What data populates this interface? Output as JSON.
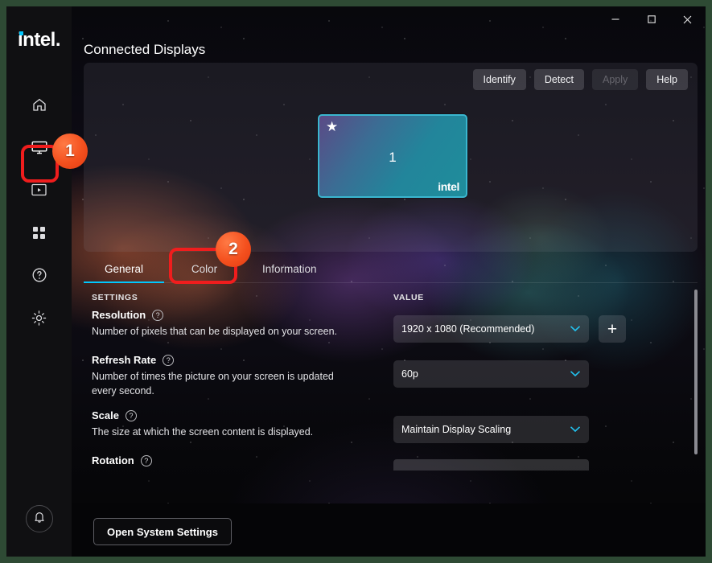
{
  "window": {
    "brand": "intel",
    "page_title": "Connected Displays",
    "controls": {
      "minimize": "minimize-icon",
      "maximize": "maximize-icon",
      "close": "close-icon"
    }
  },
  "sidebar": {
    "items": [
      {
        "id": "home",
        "icon": "home-icon",
        "label": "Home",
        "active": false
      },
      {
        "id": "display",
        "icon": "monitor-icon",
        "label": "Display",
        "active": true
      },
      {
        "id": "video",
        "icon": "video-icon",
        "label": "Video",
        "active": false
      },
      {
        "id": "apps",
        "icon": "grid-apps-icon",
        "label": "Apps",
        "active": false
      },
      {
        "id": "support",
        "icon": "question-circle-icon",
        "label": "Support",
        "active": false
      },
      {
        "id": "preferences",
        "icon": "gear-icon",
        "label": "Preferences",
        "active": false
      }
    ],
    "notification": {
      "icon": "bell-icon",
      "label": "Notifications"
    }
  },
  "toolbar": {
    "identify_label": "Identify",
    "detect_label": "Detect",
    "apply_label": "Apply",
    "apply_disabled": true,
    "help_label": "Help"
  },
  "display_preview": {
    "monitor": {
      "number": "1",
      "primary_star": "★",
      "brand": "intel",
      "selected": true,
      "border_color": "#3ab6cf"
    }
  },
  "tabs": [
    {
      "id": "general",
      "label": "General",
      "active": true
    },
    {
      "id": "color",
      "label": "Color",
      "active": false
    },
    {
      "id": "information",
      "label": "Information",
      "active": false
    }
  ],
  "settings_panel": {
    "column_headers": {
      "settings": "SETTINGS",
      "value": "VALUE"
    },
    "rows": [
      {
        "id": "resolution",
        "name": "Resolution",
        "help_icon": "question-circle-icon",
        "description": "Number of pixels that can be displayed on your screen.",
        "control": "select",
        "value": "1920 x 1080 (Recommended)",
        "chevron": "chevron-down-icon",
        "extra_button": {
          "icon": "plus-icon",
          "label": "+"
        }
      },
      {
        "id": "refresh-rate",
        "name": "Refresh Rate",
        "help_icon": "question-circle-icon",
        "description": "Number of times the picture on your screen is updated every second.",
        "control": "select",
        "value": "60p",
        "chevron": "chevron-down-icon"
      },
      {
        "id": "scale",
        "name": "Scale",
        "help_icon": "question-circle-icon",
        "description": "The size at which the screen content is displayed.",
        "control": "select",
        "value": "Maintain Display Scaling",
        "chevron": "chevron-down-icon"
      },
      {
        "id": "rotation",
        "name": "Rotation",
        "help_icon": "question-circle-icon",
        "description": "",
        "control": "select-clipped",
        "value": ""
      }
    ]
  },
  "footer": {
    "open_system_settings_label": "Open System Settings"
  },
  "annotations": [
    {
      "id": "1",
      "number": "1",
      "target": "sidebar-item-display",
      "color": "#f4501e"
    },
    {
      "id": "2",
      "number": "2",
      "target": "tab-color",
      "color": "#f4501e"
    }
  ],
  "colors": {
    "accent_cyan": "#00c7fd",
    "annotation_red": "#f01d1d",
    "annotation_orange": "#f4501e",
    "frame_green": "#2e4a34",
    "sidebar_bg": "#101012"
  },
  "scrollbar": {
    "visible": true,
    "thumb_color": "#8b8b92"
  }
}
